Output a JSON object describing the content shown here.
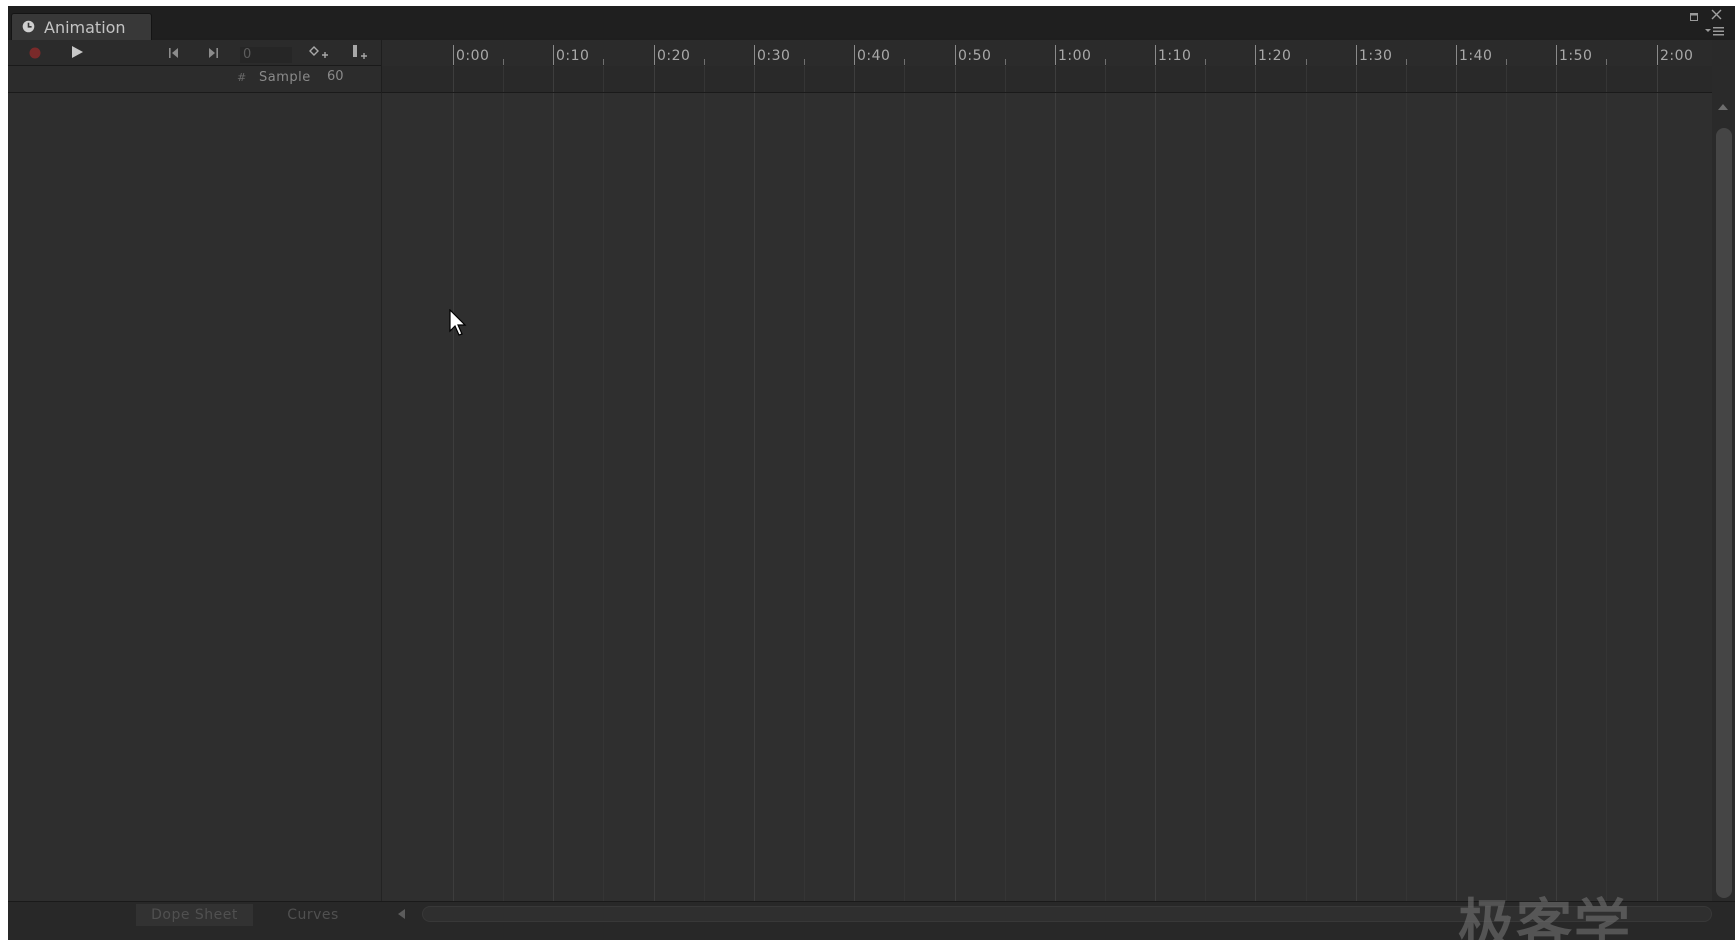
{
  "window": {
    "tab_title": "Animation",
    "tab_icon": "clock-icon",
    "maximize_icon": "maximize-icon",
    "close_icon": "close-icon",
    "menu_icon": "panel-menu-icon"
  },
  "toolbar": {
    "record_icon": "record-icon",
    "play_icon": "play-icon",
    "prev_key_icon": "previous-keyframe-icon",
    "next_key_icon": "next-keyframe-icon",
    "current_frame": "0",
    "add_keyframe_icon": "add-keyframe-icon",
    "add_event_icon": "add-event-icon",
    "sample_hash": "#",
    "sample_label": "Sample",
    "sample_value": "60"
  },
  "ruler": {
    "labels": [
      "0:00",
      "0:10",
      "0:20",
      "0:30",
      "0:40",
      "0:50",
      "1:00",
      "1:10",
      "1:20",
      "1:30",
      "1:40",
      "1:50",
      "2:00"
    ]
  },
  "bottom": {
    "dopesheet_label": "Dope Sheet",
    "curves_label": "Curves"
  },
  "watermark": "极客学",
  "colors": {
    "panel_bg": "#2e2e2e",
    "timeline_bg": "#2f2f2f",
    "record_red": "#7a2a2a"
  }
}
